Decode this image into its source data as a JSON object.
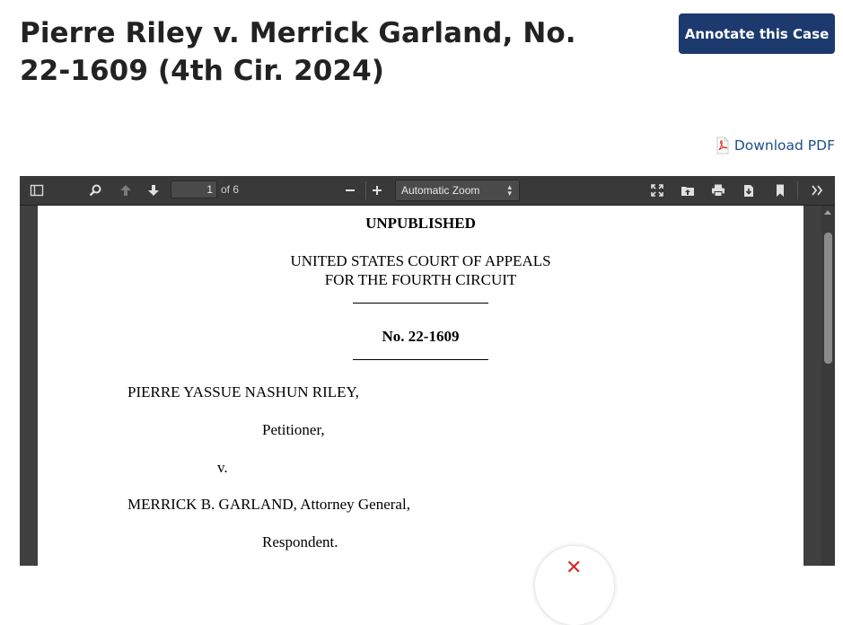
{
  "case": {
    "title": "Pierre Riley v. Merrick Garland, No. 22-1609 (4th Cir. 2024)",
    "annotate_label": "Annotate this Case",
    "download_pdf_label": "Download PDF"
  },
  "viewer": {
    "toolbar": {
      "page_number": "1",
      "page_of": "of 6",
      "zoom": "Automatic Zoom",
      "icons": [
        "sidebar-toggle-icon",
        "search-icon",
        "previous-page-icon",
        "next-page-icon",
        "zoom-out-icon",
        "zoom-in-icon",
        "presentation-mode-icon",
        "open-file-icon",
        "print-icon",
        "download-icon",
        "bookmark-icon",
        "tools-icon"
      ]
    },
    "document": {
      "status": "UNPUBLISHED",
      "court_line1": "UNITED STATES COURT OF APPEALS",
      "court_line2": "FOR THE FOURTH CIRCUIT",
      "docket": "No. 22-1609",
      "petitioner_name": "PIERRE YASSUE NASHUN RILEY,",
      "petitioner_role": "Petitioner,",
      "versus": "v.",
      "respondent_name": "MERRICK B. GARLAND, Attorney General,",
      "respondent_role": "Respondent."
    }
  },
  "colors": {
    "annotate_button": "#1c3a6e",
    "link": "#1c4f8a",
    "viewer_toolbar": "#393939",
    "viewer_background": "#404040",
    "close_icon": "#d12a2a"
  }
}
